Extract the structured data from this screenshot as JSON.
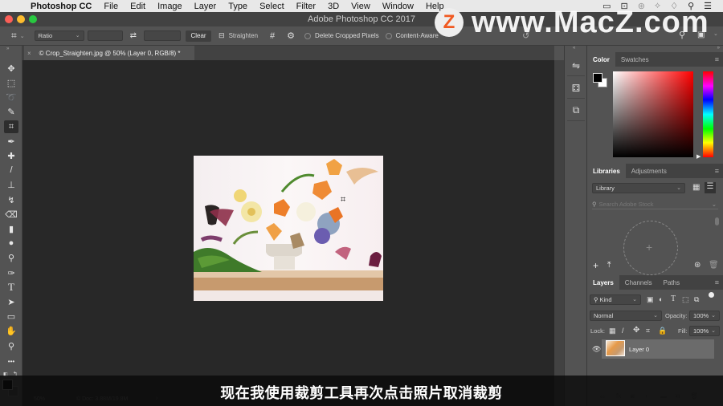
{
  "menubar": {
    "app_name": "Photoshop CC",
    "items": [
      "File",
      "Edit",
      "Image",
      "Layer",
      "Type",
      "Select",
      "Filter",
      "3D",
      "View",
      "Window",
      "Help"
    ]
  },
  "window": {
    "title": "Adobe Photoshop CC 2017"
  },
  "options_bar": {
    "ratio_select": "Ratio",
    "width_value": "",
    "height_value": "",
    "clear_label": "Clear",
    "straighten_label": "Straighten",
    "delete_cropped_label": "Delete Cropped Pixels",
    "content_aware_label": "Content-Aware"
  },
  "document": {
    "tab_label": "© Crop_Straighten.jpg @ 50% (Layer 0, RGB/8) *",
    "close_glyph": "×"
  },
  "tools": [
    {
      "name": "move-tool",
      "glyph": "✥"
    },
    {
      "name": "marquee-tool",
      "glyph": "⬚"
    },
    {
      "name": "lasso-tool",
      "glyph": "➰"
    },
    {
      "name": "quick-selection-tool",
      "glyph": "✎"
    },
    {
      "name": "crop-tool",
      "glyph": "⌗"
    },
    {
      "name": "eyedropper-tool",
      "glyph": "✒"
    },
    {
      "name": "healing-brush-tool",
      "glyph": "✚"
    },
    {
      "name": "brush-tool",
      "glyph": "/"
    },
    {
      "name": "clone-stamp-tool",
      "glyph": "⊥"
    },
    {
      "name": "history-brush-tool",
      "glyph": "↯"
    },
    {
      "name": "eraser-tool",
      "glyph": "⌫"
    },
    {
      "name": "gradient-tool",
      "glyph": "▮"
    },
    {
      "name": "blur-tool",
      "glyph": "●"
    },
    {
      "name": "dodge-tool",
      "glyph": "⚲"
    },
    {
      "name": "pen-tool",
      "glyph": "✑"
    },
    {
      "name": "type-tool",
      "glyph": "T"
    },
    {
      "name": "path-selection-tool",
      "glyph": "➤"
    },
    {
      "name": "rectangle-tool",
      "glyph": "▭"
    },
    {
      "name": "hand-tool",
      "glyph": "✋"
    },
    {
      "name": "zoom-tool",
      "glyph": "⚲"
    },
    {
      "name": "edit-toolbar",
      "glyph": "•••"
    }
  ],
  "panels": {
    "color": {
      "tabs": [
        "Color",
        "Swatches"
      ],
      "foreground": "#000000",
      "background": "#ffffff",
      "hue_color": "#ff0000"
    },
    "libraries": {
      "tabs": [
        "Libraries",
        "Adjustments"
      ],
      "library_select": "Library",
      "search_placeholder": "Search Adobe Stock"
    },
    "layers": {
      "tabs": [
        "Layers",
        "Channels",
        "Paths"
      ],
      "filter_kind": "Kind",
      "blend_mode": "Normal",
      "opacity_label": "Opacity:",
      "opacity_value": "100%",
      "lock_label": "Lock:",
      "fill_label": "Fill:",
      "fill_value": "100%",
      "layer_items": [
        {
          "name": "Layer 0",
          "visible": true
        }
      ]
    }
  },
  "status_bar": {
    "zoom": "50%",
    "doc_info": "© Doc: 3.88M/19.8M"
  },
  "subtitle": "现在我使用裁剪工具再次点击照片取消裁剪",
  "watermark": {
    "logo_letter": "Z",
    "text": "www.MacZ.com"
  }
}
